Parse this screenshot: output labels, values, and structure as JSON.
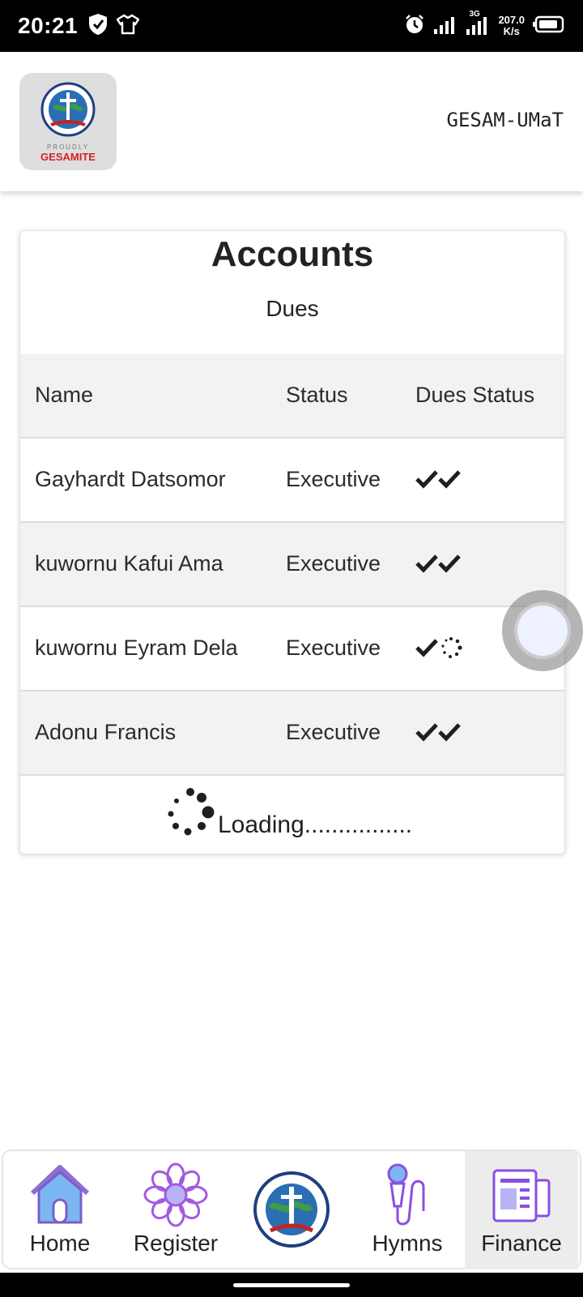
{
  "status_bar": {
    "time": "20:21",
    "speed_value": "207.0",
    "speed_unit": "K/s",
    "network_label": "3G"
  },
  "header": {
    "logo_tagline": "PROUDLY",
    "logo_text": "GESAMITE",
    "app_title": "GESAM-UMaT"
  },
  "card": {
    "title": "Accounts",
    "subtitle": "Dues",
    "columns": [
      "Name",
      "Status",
      "Dues Status"
    ],
    "rows": [
      {
        "name": "Gayhardt Datsomor",
        "status": "Executive",
        "dues": "paid"
      },
      {
        "name": "kuwornu Kafui Ama",
        "status": "Executive",
        "dues": "paid"
      },
      {
        "name": "kuwornu Eyram Dela",
        "status": "Executive",
        "dues": "pending"
      },
      {
        "name": "Adonu Francis",
        "status": "Executive",
        "dues": "paid"
      }
    ],
    "loading_text": "Loading................"
  },
  "bottom_nav": {
    "items": [
      {
        "label": "Home",
        "icon": "home-icon"
      },
      {
        "label": "Register",
        "icon": "register-icon"
      },
      {
        "label": "",
        "icon": "gesam-logo-icon"
      },
      {
        "label": "Hymns",
        "icon": "microphone-icon"
      },
      {
        "label": "Finance",
        "icon": "finance-icon",
        "active": true
      }
    ]
  }
}
